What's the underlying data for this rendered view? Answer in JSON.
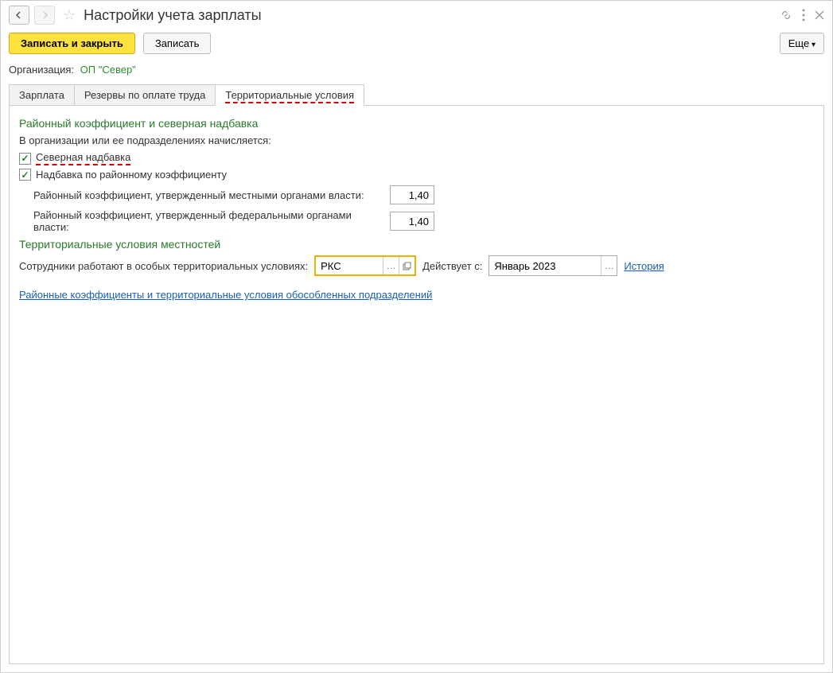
{
  "title": "Настройки учета зарплаты",
  "toolbar": {
    "save_close": "Записать и закрыть",
    "save": "Записать",
    "more": "Еще"
  },
  "org": {
    "label": "Организация:",
    "value": "ОП \"Север\""
  },
  "tabs": {
    "t1": "Зарплата",
    "t2": "Резервы по оплате труда",
    "t3": "Территориальные условия"
  },
  "section1": {
    "title": "Районный коэффициент и северная надбавка",
    "hint": "В организации или ее подразделениях начисляется:",
    "chk1": "Северная надбавка",
    "chk2": "Надбавка по районному коэффициенту",
    "coef1_label": "Районный коэффициент, утвержденный местными органами власти:",
    "coef1_value": "1,40",
    "coef2_label": "Районный коэффициент, утвержденный федеральными органами власти:",
    "coef2_value": "1,40"
  },
  "section2": {
    "title": "Территориальные условия местностей",
    "cond_label": "Сотрудники работают в особых территориальных условиях:",
    "cond_value": "РКС",
    "date_label": "Действует с:",
    "date_value": "Январь 2023",
    "history": "История"
  },
  "link": "Районные коэффициенты и территориальные условия обособленных подразделений"
}
